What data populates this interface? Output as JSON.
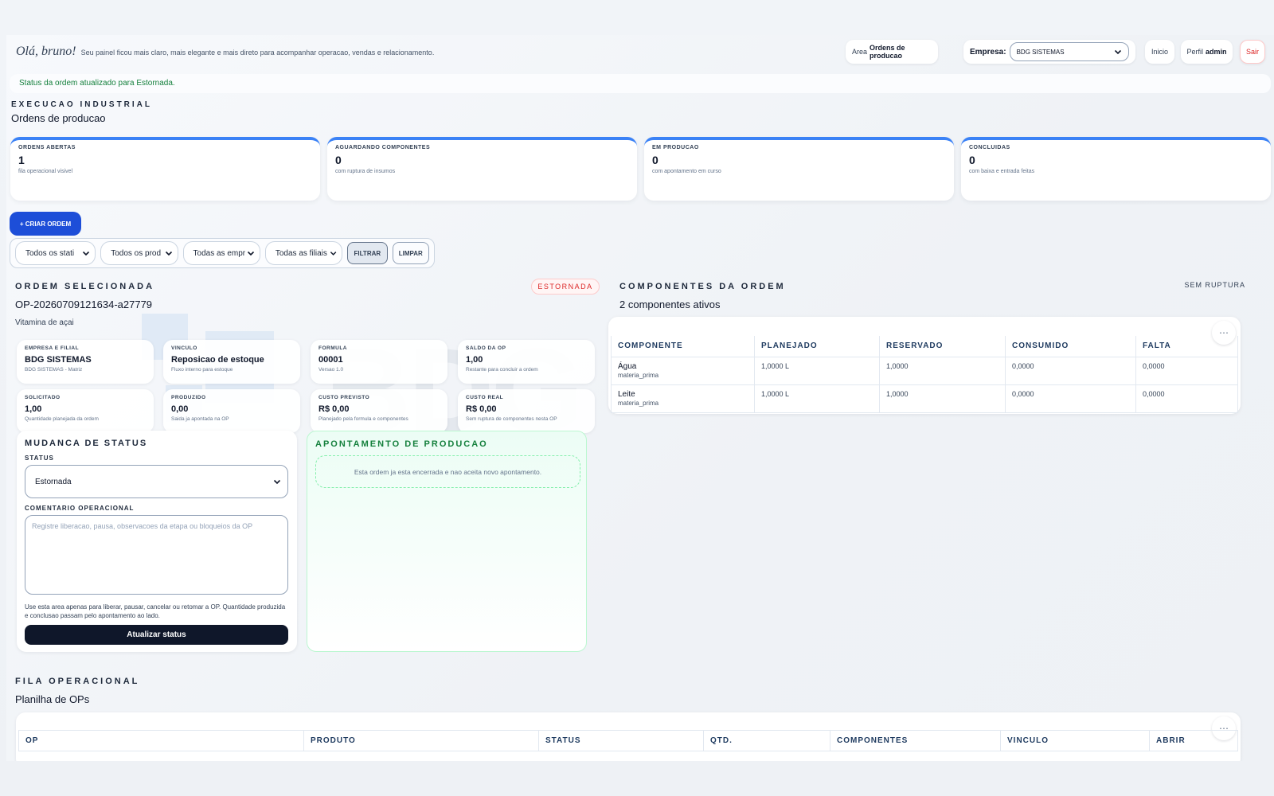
{
  "header": {
    "greeting": "Olá, bruno!",
    "subtitle": "Seu painel ficou mais claro, mais elegante e mais direto para acompanhar operacao, vendas e relacionamento.",
    "area_label": "Area",
    "area_value": "Ordens de producao",
    "empresa_label": "Empresa:",
    "empresa_value": "BDG SISTEMAS",
    "inicio": "Inicio",
    "perfil_label": "Perfil",
    "perfil_value": "admin",
    "sair": "Sair"
  },
  "alert": "Status da ordem atualizado para Estornada.",
  "section": {
    "eyebrow": "EXECUCAO INDUSTRIAL",
    "title": "Ordens de producao"
  },
  "kpis": [
    {
      "label": "ORDENS ABERTAS",
      "value": "1",
      "note": "fila operacional visivel"
    },
    {
      "label": "AGUARDANDO COMPONENTES",
      "value": "0",
      "note": "com ruptura de insumos"
    },
    {
      "label": "EM PRODUCAO",
      "value": "0",
      "note": "com apontamento em curso"
    },
    {
      "label": "CONCLUIDAS",
      "value": "0",
      "note": "com baixa e entrada feitas"
    }
  ],
  "actions": {
    "create": "+ CRIAR ORDEM"
  },
  "filters": {
    "status": "Todos os stati",
    "produto": "Todos os prod",
    "empresa": "Todas as empr",
    "filial": "Todas as filiais",
    "filtrar": "FILTRAR",
    "limpar": "LIMPAR"
  },
  "watermark": "BDG",
  "ordem": {
    "eyebrow": "ORDEM SELECIONADA",
    "code": "OP-20260709121634-a27779",
    "product": "Vitamina de açai",
    "badge": "ESTORNADA",
    "cards": [
      {
        "label": "EMPRESA E FILIAL",
        "value": "BDG SISTEMAS",
        "note": "BDG SISTEMAS - Matriz"
      },
      {
        "label": "VINCULO",
        "value": "Reposicao de estoque",
        "note": "Fluxo interno para estoque"
      },
      {
        "label": "FORMULA",
        "value": "00001",
        "note": "Versao 1.0"
      },
      {
        "label": "SALDO DA OP",
        "value": "1,00",
        "note": "Restante para concluir a ordem"
      },
      {
        "label": "SOLICITADO",
        "value": "1,00",
        "note": "Quantidade planejada da ordem"
      },
      {
        "label": "PRODUZIDO",
        "value": "0,00",
        "note": "Saida ja apontada na OP"
      },
      {
        "label": "CUSTO PREVISTO",
        "value": "R$ 0,00",
        "note": "Planejado pela formula e componentes"
      },
      {
        "label": "CUSTO REAL",
        "value": "R$ 0,00",
        "note": "Sem ruptura de componentes nesta OP"
      }
    ]
  },
  "status_change": {
    "title": "MUDANCA DE STATUS",
    "status_label": "STATUS",
    "status_value": "Estornada",
    "comment_label": "COMENTARIO OPERACIONAL",
    "comment_placeholder": "Registre liberacao, pausa, observacoes da etapa ou bloqueios da OP",
    "help": "Use esta area apenas para liberar, pausar, cancelar ou retomar a OP. Quantidade produzida e conclusao passam pelo apontamento ao lado.",
    "button": "Atualizar status"
  },
  "apontamento": {
    "title": "APONTAMENTO DE PRODUCAO",
    "message": "Esta ordem ja esta encerrada e nao aceita novo apontamento."
  },
  "componentes": {
    "eyebrow": "COMPONENTES DA ORDEM",
    "title": "2 componentes ativos",
    "badge": "SEM RUPTURA",
    "columns": [
      "COMPONENTE",
      "PLANEJADO",
      "RESERVADO",
      "CONSUMIDO",
      "FALTA"
    ],
    "rows": [
      {
        "name": "Água",
        "type": "materia_prima",
        "planejado": "1,0000 L",
        "reservado": "1,0000",
        "consumido": "0,0000",
        "falta": "0,0000"
      },
      {
        "name": "Leite",
        "type": "materia_prima",
        "planejado": "1,0000 L",
        "reservado": "1,0000",
        "consumido": "0,0000",
        "falta": "0,0000"
      }
    ]
  },
  "fila": {
    "eyebrow": "FILA OPERACIONAL",
    "title": "Planilha de OPs",
    "columns": [
      "OP",
      "PRODUTO",
      "STATUS",
      "QTD.",
      "COMPONENTES",
      "VINCULO",
      "ABRIR"
    ]
  },
  "icons": {
    "more": "ellipsis-icon",
    "chevron": "chevron-down-icon"
  },
  "colors": {
    "primary": "#1d4ed8",
    "danger": "#dc2626",
    "success": "#15803d",
    "dark": "#0f172a"
  }
}
